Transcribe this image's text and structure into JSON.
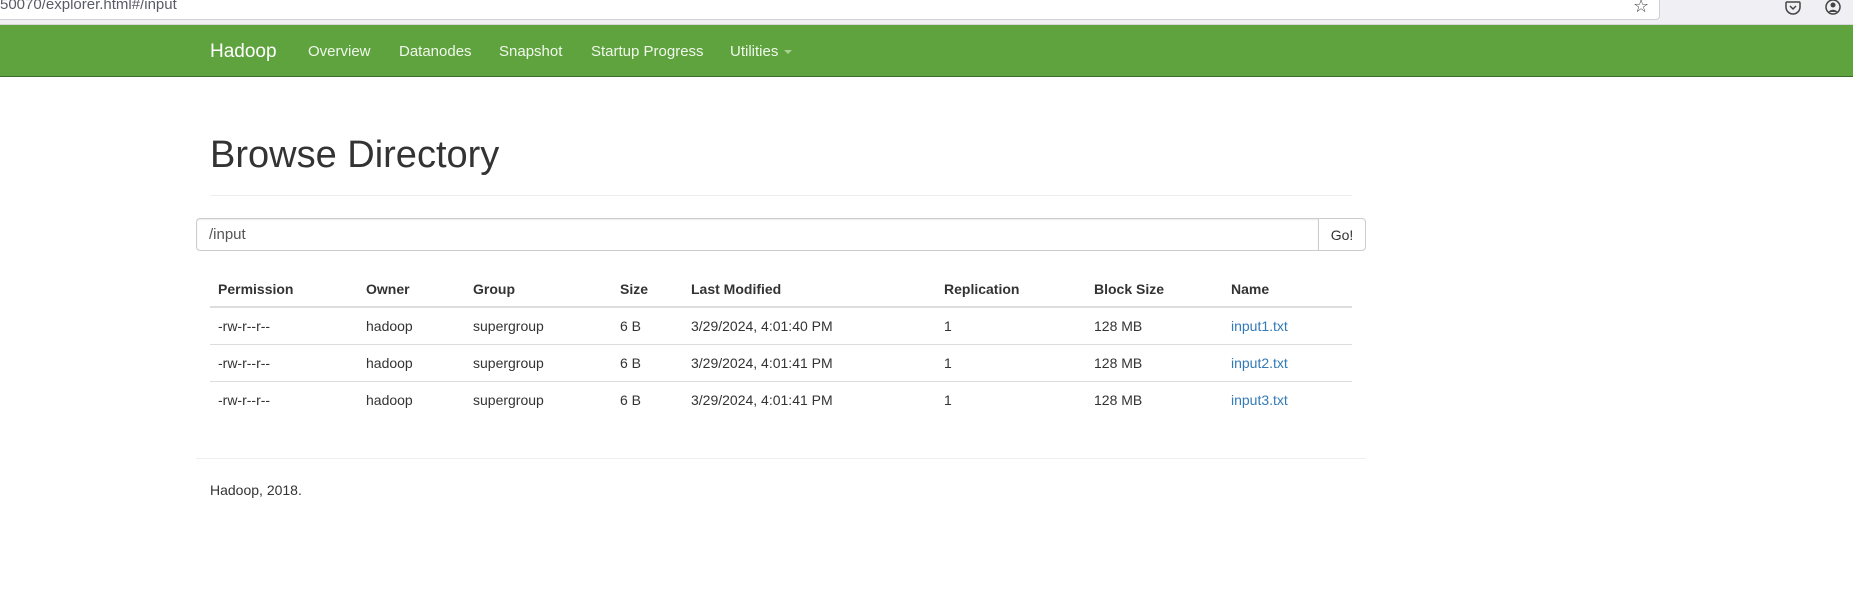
{
  "browser": {
    "url": "50070/explorer.html#/input",
    "bookmark_icon": "star-icon",
    "toolbar_icons": [
      "pocket-icon",
      "account-icon"
    ]
  },
  "navbar": {
    "brand": "Hadoop",
    "items": [
      {
        "label": "Overview"
      },
      {
        "label": "Datanodes"
      },
      {
        "label": "Snapshot"
      },
      {
        "label": "Startup Progress"
      },
      {
        "label": "Utilities",
        "dropdown": true
      }
    ],
    "color": "#5fa33e"
  },
  "page": {
    "title": "Browse Directory"
  },
  "path_bar": {
    "value": "/input",
    "go_label": "Go!"
  },
  "table": {
    "headers": [
      "Permission",
      "Owner",
      "Group",
      "Size",
      "Last Modified",
      "Replication",
      "Block Size",
      "Name"
    ],
    "rows": [
      [
        "-rw-r--r--",
        "hadoop",
        "supergroup",
        "6 B",
        "3/29/2024, 4:01:40 PM",
        "1",
        "128 MB",
        "input1.txt"
      ],
      [
        "-rw-r--r--",
        "hadoop",
        "supergroup",
        "6 B",
        "3/29/2024, 4:01:41 PM",
        "1",
        "128 MB",
        "input2.txt"
      ],
      [
        "-rw-r--r--",
        "hadoop",
        "supergroup",
        "6 B",
        "3/29/2024, 4:01:41 PM",
        "1",
        "128 MB",
        "input3.txt"
      ]
    ],
    "link_color": "#337ab7"
  },
  "footer": {
    "text": "Hadoop, 2018."
  }
}
